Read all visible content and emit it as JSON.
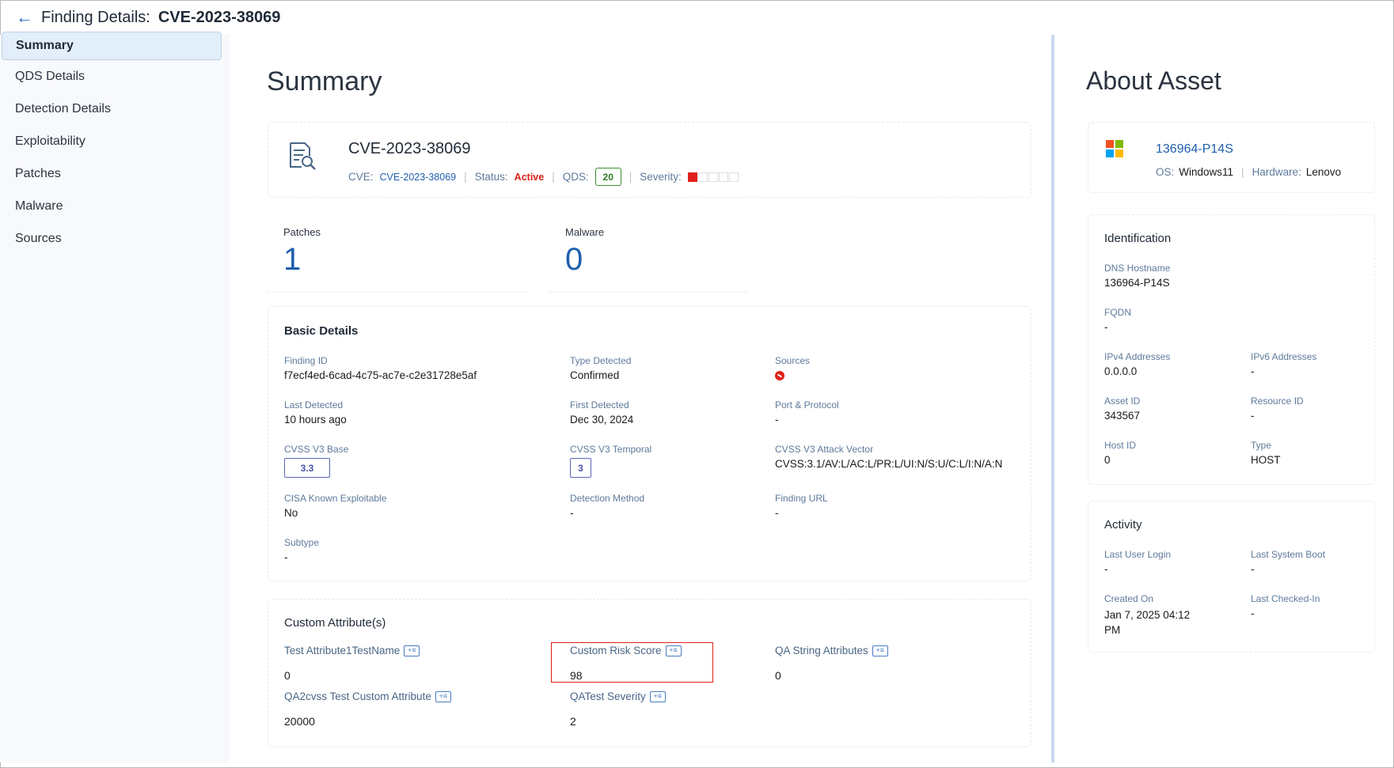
{
  "header": {
    "title": "Finding Details:",
    "cve": "CVE-2023-38069"
  },
  "sidebar": {
    "items": [
      {
        "label": "Summary"
      },
      {
        "label": "QDS Details"
      },
      {
        "label": "Detection Details"
      },
      {
        "label": "Exploitability"
      },
      {
        "label": "Patches"
      },
      {
        "label": "Malware"
      },
      {
        "label": "Sources"
      }
    ]
  },
  "summary": {
    "title": "Summary",
    "vuln": {
      "title": "CVE-2023-38069",
      "cve_label": "CVE:",
      "cve_value": "CVE-2023-38069",
      "status_label": "Status:",
      "status_value": "Active",
      "qds_label": "QDS:",
      "qds_value": "20",
      "severity_label": "Severity:",
      "severity_level": 1,
      "severity_max": 5
    },
    "patches": {
      "label": "Patches",
      "value": "1"
    },
    "malware": {
      "label": "Malware",
      "value": "0"
    },
    "basic": {
      "heading": "Basic Details",
      "finding_id": {
        "label": "Finding ID",
        "value": "f7ecf4ed-6cad-4c75-ac7e-c2e31728e5af"
      },
      "type_detected": {
        "label": "Type Detected",
        "value": "Confirmed"
      },
      "sources": {
        "label": "Sources"
      },
      "last_detected": {
        "label": "Last Detected",
        "value": "10 hours ago"
      },
      "first_detected": {
        "label": "First Detected",
        "value": "Dec 30, 2024"
      },
      "port_protocol": {
        "label": "Port & Protocol",
        "value": "-"
      },
      "cvss_base": {
        "label": "CVSS V3 Base",
        "value": "3.3"
      },
      "cvss_temporal": {
        "label": "CVSS V3 Temporal",
        "value": "3"
      },
      "cvss_vector": {
        "label": "CVSS V3 Attack Vector",
        "value": "CVSS:3.1/AV:L/AC:L/PR:L/UI:N/S:U/C:L/I:N/A:N"
      },
      "cisa": {
        "label": "CISA Known Exploitable",
        "value": "No"
      },
      "detection_method": {
        "label": "Detection Method",
        "value": "-"
      },
      "finding_url": {
        "label": "Finding URL",
        "value": "-"
      },
      "subtype": {
        "label": "Subtype",
        "value": "-"
      }
    },
    "custom": {
      "heading": "Custom Attribute(s)",
      "attrs": [
        {
          "label": "Test Attribute1TestName",
          "value": "0"
        },
        {
          "label": "Custom Risk Score",
          "value": "98"
        },
        {
          "label": "QA String Attributes",
          "value": "0"
        },
        {
          "label": "QA2cvss Test Custom Attribute",
          "value": "20000"
        },
        {
          "label": "QATest Severity",
          "value": "2"
        }
      ]
    }
  },
  "about": {
    "title": "About Asset",
    "asset_name": "136964-P14S",
    "os_label": "OS:",
    "os_value": "Windows11",
    "hardware_label": "Hardware:",
    "hardware_value": "Lenovo",
    "identification": {
      "heading": "Identification",
      "dns": {
        "label": "DNS Hostname",
        "value": "136964-P14S"
      },
      "fqdn": {
        "label": "FQDN",
        "value": "-"
      },
      "ipv4": {
        "label": "IPv4 Addresses",
        "value": "0.0.0.0"
      },
      "ipv6": {
        "label": "IPv6 Addresses",
        "value": "-"
      },
      "asset_id": {
        "label": "Asset ID",
        "value": "343567"
      },
      "resource_id": {
        "label": "Resource ID",
        "value": "-"
      },
      "host_id": {
        "label": "Host ID",
        "value": "0"
      },
      "type": {
        "label": "Type",
        "value": "HOST"
      }
    },
    "activity": {
      "heading": "Activity",
      "last_login": {
        "label": "Last User Login",
        "value": "-"
      },
      "last_boot": {
        "label": "Last System Boot",
        "value": "-"
      },
      "created_on": {
        "label": "Created On",
        "value": "Jan 7, 2025 04:12 PM"
      },
      "last_checked": {
        "label": "Last Checked-In",
        "value": "-"
      }
    }
  },
  "colors": {
    "accent": "#1f5fae",
    "status_active": "#e0201a",
    "qds_green": "#3c8a2f",
    "highlight_red": "#e0201a"
  },
  "icons": {
    "back": "arrow-left-icon",
    "finding": "document-search-icon",
    "source": "source-icon",
    "attribute": "attribute-edit-icon",
    "os": "windows-logo-icon"
  }
}
